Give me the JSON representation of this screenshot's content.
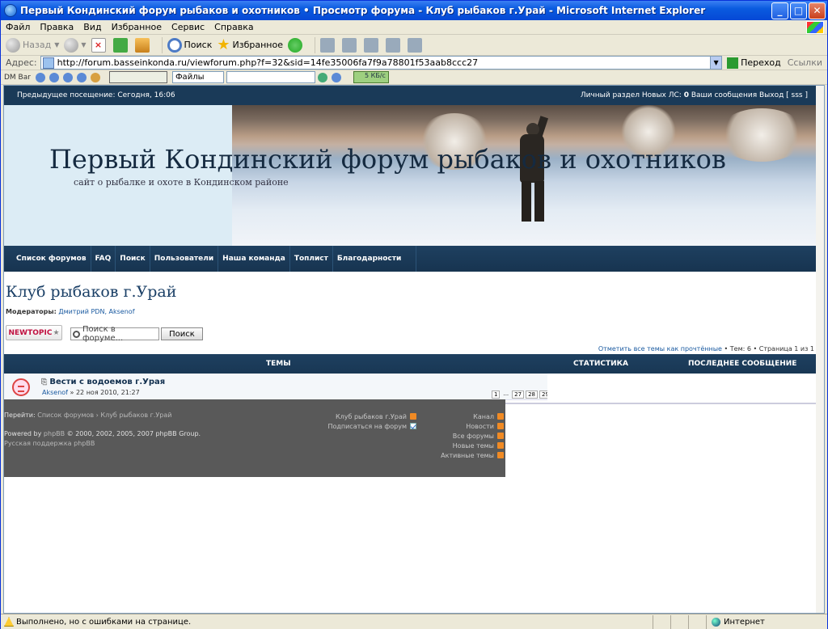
{
  "window": {
    "title": "Первый Кондинский форум рыбаков и охотников • Просмотр форума - Клуб рыбаков г.Урай - Microsoft Internet Explorer",
    "minimize": "_",
    "maximize": "□",
    "close": "✕"
  },
  "menu": [
    "Файл",
    "Правка",
    "Вид",
    "Избранное",
    "Сервис",
    "Справка"
  ],
  "toolbar": {
    "back_label": "Назад",
    "search_label": "Поиск",
    "favorites_label": "Избранное"
  },
  "address": {
    "label": "Адрес:",
    "url": "http://forum.basseinkonda.ru/viewforum.php?f=32&sid=14fe35006fa7f9a78801f53aab8ccc27",
    "go_label": "Переход",
    "links_label": "Ссылки"
  },
  "dmbar": {
    "label": "DM Bar",
    "files_label": "Файлы",
    "speed": "5 КБ/с"
  },
  "forum_nav": {
    "last_visit": "Предыдущее посещение: Сегодня, 16:06",
    "user_links_prefix": "Личный раздел Новых ЛС: ",
    "new_pm_count": "0",
    "user_links_suffix": " Ваши сообщения Выход [ sss ]"
  },
  "banner": {
    "title": "Первый Кондинский форум рыбаков и охотников",
    "subtitle": "сайт о рыбалке и охоте в Кондинском районе"
  },
  "main_nav": [
    "Список форумов",
    "FAQ",
    "Поиск",
    "Пользователи",
    "Наша команда",
    "Топлист",
    "Благодарности"
  ],
  "forum": {
    "title": "Клуб рыбаков г.Урай",
    "moderators_label": "Модераторы:",
    "moderators": "Дмитрий PDN, Aksenof",
    "new_topic": "NEWTOPIC",
    "search_placeholder": "Поиск в форуме...",
    "search_button": "Поиск",
    "mark_read": "Отметить все темы как прочтённые",
    "stats": " • Тем: 6 • Страница 1 из 1"
  },
  "table": {
    "col_topics": "ТЕМЫ",
    "col_stats": "СТАТИСТИКА",
    "col_last": "ПОСЛЕДНЕЕ СООБЩЕНИЕ"
  },
  "topics": [
    {
      "title": "Вести с водоемов г.Урая",
      "author": "Aksenof",
      "date": " » 22 ноя 2010, 21:27",
      "pages": [
        "1",
        "...",
        "27",
        "28",
        "29"
      ]
    }
  ],
  "footer": {
    "jump_label": "Перейти: ",
    "jump_path": "Список форумов › Клуб рыбаков г.Урай",
    "powered_prefix": "Powered by ",
    "phpbb": "phpBB",
    "powered_suffix": " © 2000, 2002, 2005, 2007 phpBB Group.",
    "ru_support": "Русская поддержка phpBB",
    "feed_forum": "Клуб рыбаков г.Урай",
    "subscribe": "Подписаться на форум",
    "feeds": [
      "Канал",
      "Новости",
      "Все форумы",
      "Новые темы",
      "Активные темы"
    ]
  },
  "status": {
    "message": "Выполнено, но с ошибками на странице.",
    "zone": "Интернет"
  }
}
